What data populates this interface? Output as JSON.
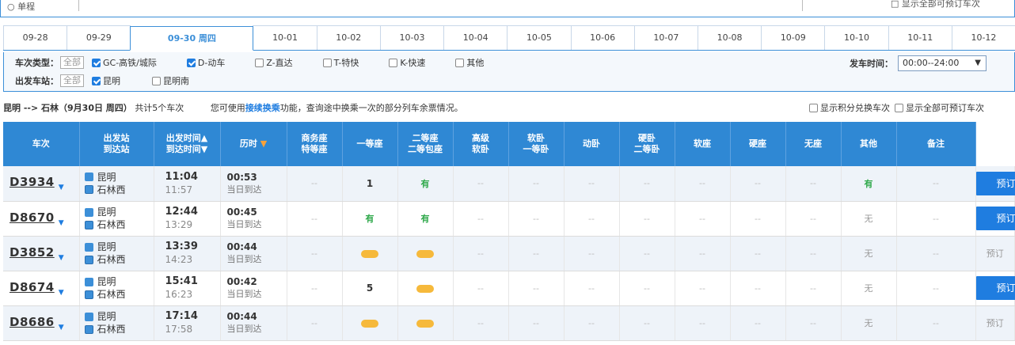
{
  "topbar": {
    "left_text": "○ 单程",
    "right_text": "□ 显示全部可预订车次"
  },
  "dates": [
    "09-28",
    "09-29",
    "09-30 周四",
    "10-01",
    "10-02",
    "10-03",
    "10-04",
    "10-05",
    "10-06",
    "10-07",
    "10-08",
    "10-09",
    "10-10",
    "10-11",
    "10-12"
  ],
  "active_date_index": 2,
  "filters": {
    "type_label": "车次类型：",
    "type_all": "全部",
    "type_options": [
      {
        "label": "GC-高铁/城际",
        "checked": true
      },
      {
        "label": "D-动车",
        "checked": true
      },
      {
        "label": "Z-直达",
        "checked": false
      },
      {
        "label": "T-特快",
        "checked": false
      },
      {
        "label": "K-快速",
        "checked": false
      },
      {
        "label": "其他",
        "checked": false
      }
    ],
    "station_label": "出发车站：",
    "station_all": "全部",
    "station_options": [
      {
        "label": "昆明",
        "checked": true
      },
      {
        "label": "昆明南",
        "checked": false
      }
    ],
    "time_label": "发车时间：",
    "time_value": "00:00--24:00"
  },
  "summary": {
    "route": "昆明 --> 石林（9月30日 周四）",
    "count": "共计5个车次",
    "hint_pre": "您可使用",
    "hint_link": "接续换乘",
    "hint_post": "功能，查询途中换乘一次的部分列车余票情况。",
    "opt1": "显示积分兑换车次",
    "opt2": "显示全部可预订车次"
  },
  "headers": {
    "train": "车次",
    "station_top": "出发站",
    "station_bot": "到达站",
    "time_top": "出发时间",
    "time_bot": "到达时间",
    "dur": "历时",
    "c_business": [
      "商务座",
      "特等座"
    ],
    "c_first": "一等座",
    "c_second": [
      "二等座",
      "二等包座"
    ],
    "c_hs_sleep": [
      "高级",
      "软卧"
    ],
    "c_soft_sleep": [
      "软卧",
      "一等卧"
    ],
    "c_moving": "动卧",
    "c_hard_sleep": [
      "硬卧",
      "二等卧"
    ],
    "c_soft_seat": "软座",
    "c_hard_seat": "硬座",
    "c_no_seat": "无座",
    "c_other": "其他",
    "c_remark": "备注"
  },
  "rows": [
    {
      "train": "D3934",
      "from": "昆明",
      "to": "石林西",
      "dep": "11:04",
      "arr": "11:57",
      "dur": "00:53",
      "note": "当日到达",
      "seats": [
        "--",
        "1",
        "有",
        "--",
        "--",
        "--",
        "--",
        "--",
        "--",
        "--",
        "有",
        "--"
      ],
      "book": "预订",
      "bookable": true,
      "corner": false
    },
    {
      "train": "D8670",
      "from": "昆明",
      "to": "石林西",
      "dep": "12:44",
      "arr": "13:29",
      "dur": "00:45",
      "note": "当日到达",
      "seats": [
        "--",
        "有",
        "有",
        "--",
        "--",
        "--",
        "--",
        "--",
        "--",
        "--",
        "无",
        "--"
      ],
      "book": "预订",
      "bookable": true,
      "corner": false
    },
    {
      "train": "D3852",
      "from": "昆明",
      "to": "石林西",
      "dep": "13:39",
      "arr": "14:23",
      "dur": "00:44",
      "note": "当日到达",
      "seats": [
        "--",
        "候补",
        "候补",
        "--",
        "--",
        "--",
        "--",
        "--",
        "--",
        "--",
        "无",
        "--"
      ],
      "book": "预订",
      "bookable": false,
      "corner": false
    },
    {
      "train": "D8674",
      "from": "昆明",
      "to": "石林西",
      "dep": "15:41",
      "arr": "16:23",
      "dur": "00:42",
      "note": "当日到达",
      "seats": [
        "--",
        "5",
        "候补",
        "--",
        "--",
        "--",
        "--",
        "--",
        "--",
        "--",
        "无",
        "--"
      ],
      "book": "预订",
      "bookable": true,
      "corner": true
    },
    {
      "train": "D8686",
      "from": "昆明",
      "to": "石林西",
      "dep": "17:14",
      "arr": "17:58",
      "dur": "00:44",
      "note": "当日到达",
      "seats": [
        "--",
        "候补",
        "候补",
        "--",
        "--",
        "--",
        "--",
        "--",
        "--",
        "--",
        "无",
        "--"
      ],
      "book": "预订",
      "bookable": false,
      "corner": false
    }
  ],
  "colors": {
    "accent": "#2f88d4",
    "have": "#2ea84a",
    "candidate": "#f6b93b",
    "corner": "#f6a623"
  }
}
